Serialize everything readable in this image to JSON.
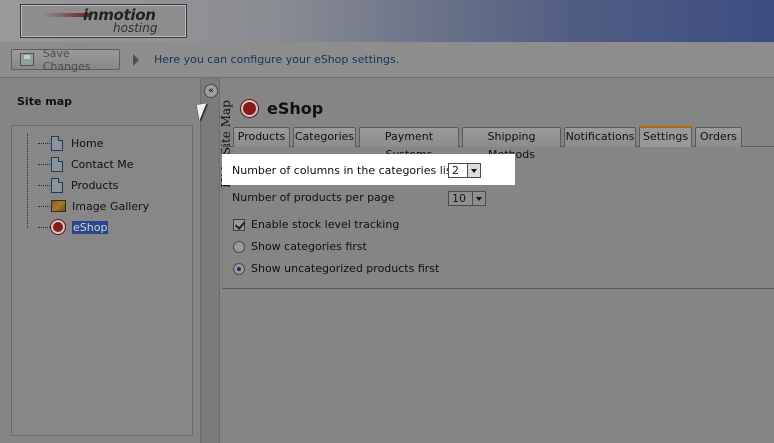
{
  "header": {
    "logo_word": "inmotion",
    "logo_sub": "hosting"
  },
  "toolbar": {
    "save_label": "Save Changes",
    "info_text": "Here you can configure your eShop settings."
  },
  "sidebar": {
    "title": "Site map",
    "hide_label": "Hide Site Map",
    "items": [
      {
        "label": "Home",
        "icon": "page-icon"
      },
      {
        "label": "Contact Me",
        "icon": "page-icon"
      },
      {
        "label": "Products",
        "icon": "page-icon"
      },
      {
        "label": "Image Gallery",
        "icon": "gallery-icon"
      },
      {
        "label": "eShop",
        "icon": "shop-icon",
        "selected": true
      }
    ]
  },
  "main": {
    "title": "eShop",
    "tabs": [
      {
        "label": "Products"
      },
      {
        "label": "Categories"
      },
      {
        "label": "Payment Systems"
      },
      {
        "label": "Shipping Methods"
      },
      {
        "label": "Notifications"
      },
      {
        "label": "Settings",
        "active": true
      },
      {
        "label": "Orders"
      }
    ],
    "settings": {
      "columns_label": "Number of columns in the categories list",
      "columns_value": "2",
      "products_label": "Number of products per page",
      "products_value": "10",
      "stock_label": "Enable stock level tracking",
      "stock_checked": true,
      "radio_categories_first": "Show categories first",
      "radio_uncategorized_first": "Show uncategorized products first",
      "selected_radio": "uncategorized_first"
    }
  },
  "colors": {
    "active_tab_accent": "#b26a12",
    "selected_item_bg": "#29468c",
    "header_right": "#3c4d82"
  }
}
